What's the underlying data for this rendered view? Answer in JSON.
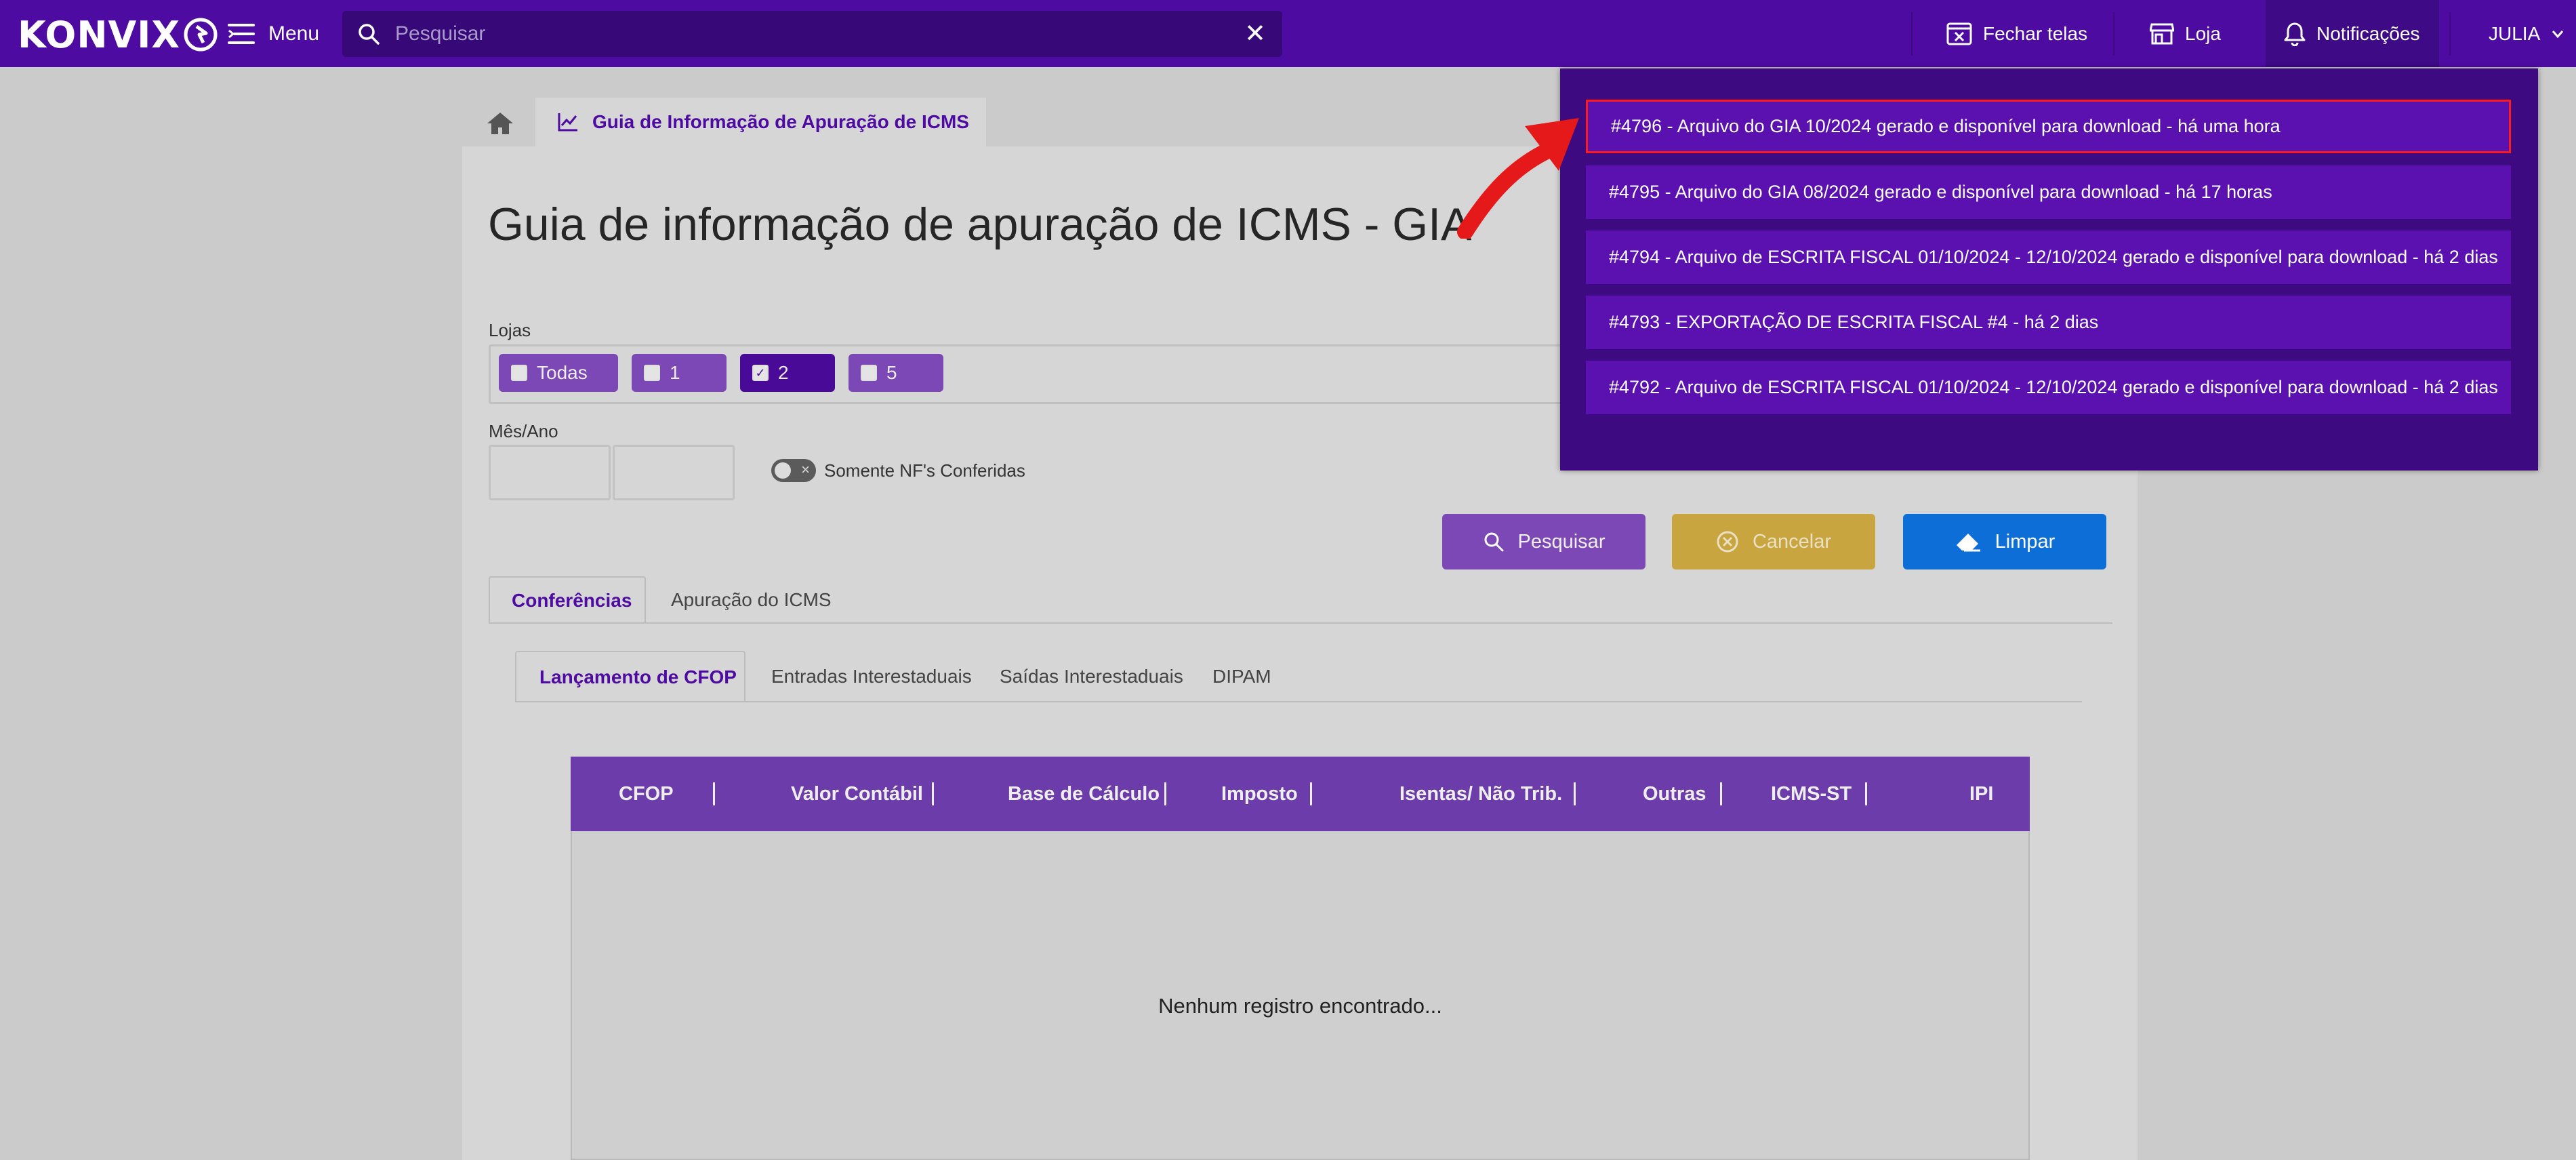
{
  "app": {
    "brand": "KONVIX",
    "colors": {
      "topbar": "#4e0ba2",
      "accent": "#4e0ba2",
      "cancel": "#c8a53f",
      "clear": "#0d6ed8",
      "search_btn": "#7b48b6",
      "highlight": "#ff1a1a"
    }
  },
  "topbar": {
    "menu_label": "Menu",
    "search_placeholder": "Pesquisar",
    "close_screens_label": "Fechar telas",
    "store_label": "Loja",
    "notifications_label": "Notificações",
    "user_label": "JULIA"
  },
  "tabs": {
    "home_icon": "home-icon",
    "active_tab_label": "Guia de Informação de Apuração de ICMS"
  },
  "page": {
    "title": "Guia de informação de apuração de ICMS - GIA",
    "lojas_label": "Lojas",
    "lojas": [
      {
        "label": "Todas",
        "checked": false
      },
      {
        "label": "1",
        "checked": false
      },
      {
        "label": "2",
        "checked": true
      },
      {
        "label": "5",
        "checked": false
      }
    ],
    "mes_ano_label": "Mês/Ano",
    "mes_value": "",
    "ano_value": "",
    "toggle_label": "Somente NF's Conferidas",
    "toggle_on": false,
    "buttons": {
      "search": "Pesquisar",
      "cancel": "Cancelar",
      "clear": "Limpar"
    },
    "main_tabs": [
      "Conferências",
      "Apuração do ICMS"
    ],
    "sub_tabs": [
      "Lançamento de CFOP",
      "Entradas Interestaduais",
      "Saídas Interestaduais",
      "DIPAM"
    ],
    "table": {
      "columns": [
        "CFOP",
        "Valor Contábil",
        "Base de Cálculo",
        "Imposto",
        "Isentas/ Não Trib.",
        "Outras",
        "ICMS-ST",
        "IPI"
      ],
      "rows": [],
      "empty_message": "Nenhum registro encontrado..."
    }
  },
  "notifications": [
    {
      "text": "#4796 - Arquivo do GIA 10/2024 gerado e disponível para download - há uma hora",
      "highlighted": true
    },
    {
      "text": "#4795 - Arquivo do GIA 08/2024 gerado e disponível para download - há 17 horas",
      "highlighted": false
    },
    {
      "text": "#4794 - Arquivo de ESCRITA FISCAL 01/10/2024 - 12/10/2024 gerado e disponível para download - há 2 dias",
      "highlighted": false
    },
    {
      "text": "#4793 - EXPORTAÇÃO DE ESCRITA FISCAL #4 - há 2 dias",
      "highlighted": false
    },
    {
      "text": "#4792 - Arquivo de ESCRITA FISCAL 01/10/2024 - 12/10/2024 gerado e disponível para download - há 2 dias",
      "highlighted": false
    }
  ]
}
